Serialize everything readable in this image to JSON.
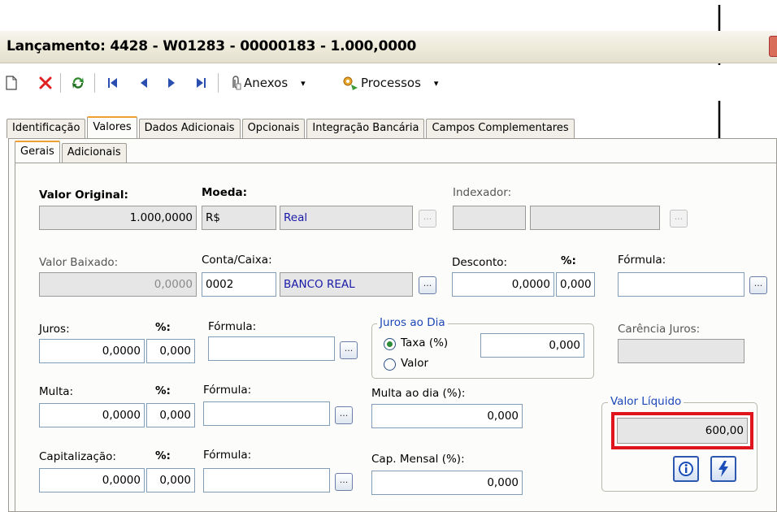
{
  "window": {
    "title": "Lançamento: 4428 - W01283 - 00000183 - 1.000,0000"
  },
  "toolbar": {
    "anexos_label": "Anexos",
    "processos_label": "Processos",
    "dropdown_glyph": "▾"
  },
  "tabs": {
    "main": [
      "Identificação",
      "Valores",
      "Dados Adicionais",
      "Opcionais",
      "Integração Bancária",
      "Campos Complementares"
    ],
    "sub": [
      "Gerais",
      "Adicionais"
    ]
  },
  "form": {
    "valor_original": {
      "label": "Valor Original:",
      "value": "1.000,0000"
    },
    "moeda": {
      "label": "Moeda:",
      "code": "R$",
      "name": "Real"
    },
    "indexador": {
      "label": "Indexador:",
      "code": "",
      "name": ""
    },
    "valor_baixado": {
      "label": "Valor Baixado:",
      "value": "0,0000"
    },
    "conta_caixa": {
      "label": "Conta/Caixa:",
      "code": "0002",
      "name": "BANCO REAL"
    },
    "desconto": {
      "label": "Desconto:",
      "pct_label": "%:",
      "value": "0,0000",
      "pct": "0,000"
    },
    "formula_desconto": {
      "label": "Fórmula:",
      "value": ""
    },
    "juros": {
      "label": "Juros:",
      "pct_label": "%:",
      "value": "0,0000",
      "pct": "0,000"
    },
    "formula_juros": {
      "label": "Fórmula:",
      "value": ""
    },
    "juros_ao_dia": {
      "legend": "Juros ao Dia",
      "taxa_label": "Taxa (%)",
      "valor_label": "Valor",
      "value": "0,000"
    },
    "carencia_juros": {
      "label": "Carência Juros:",
      "value": ""
    },
    "multa": {
      "label": "Multa:",
      "pct_label": "%:",
      "value": "0,0000",
      "pct": "0,000"
    },
    "formula_multa": {
      "label": "Fórmula:",
      "value": ""
    },
    "multa_ao_dia": {
      "label": "Multa ao dia (%):",
      "value": "0,000"
    },
    "valor_liquido": {
      "legend": "Valor Líquido",
      "value": "600,00"
    },
    "capitalizacao": {
      "label": "Capitalização:",
      "pct_label": "%:",
      "value": "0,0000",
      "pct": "0,000"
    },
    "formula_cap": {
      "label": "Fórmula:",
      "value": ""
    },
    "cap_mensal": {
      "label": "Cap. Mensal (%):",
      "value": "0,000"
    }
  },
  "colors": {
    "highlight_box": "#e0141c",
    "legend_text": "#1c47b8",
    "active_tab_accent": "#f0a030",
    "arrow": "#000000"
  },
  "icons": {
    "new": "new-document-icon",
    "delete": "delete-x-icon",
    "refresh": "refresh-icon",
    "first": "first-record-icon",
    "prev": "previous-record-icon",
    "next": "next-record-icon",
    "last": "last-record-icon",
    "attach": "paperclip-icon",
    "process": "gear-process-icon",
    "info": "info-icon",
    "calc": "lightning-calc-icon"
  }
}
